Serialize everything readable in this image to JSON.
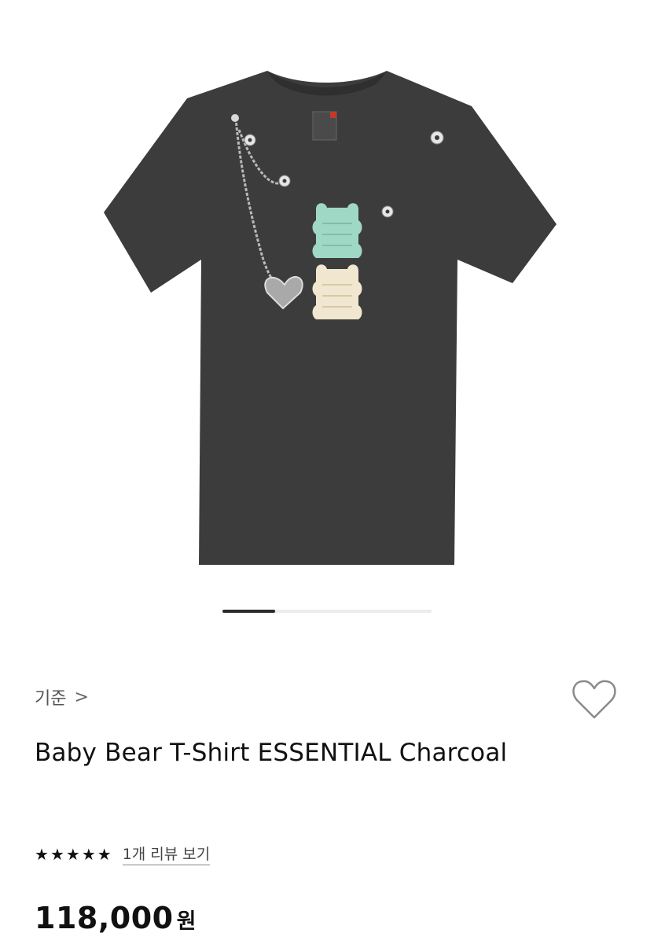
{
  "product": {
    "brand_label": "기준",
    "brand_chevron": ">",
    "title": "Baby Bear T-Shirt ESSENTIAL Charcoal",
    "rating_stars": 5,
    "review_link": "1개 리뷰 보기",
    "price": "118,000",
    "price_unit": "원"
  },
  "carousel": {
    "progress": 0.25
  },
  "icons": {
    "wishlist": "heart-outline-icon",
    "star": "star-filled-icon"
  },
  "colors": {
    "shirt": "#3c3c3c",
    "mint_patch": "#9fd8c4",
    "cream_patch": "#f1e6cf",
    "accent_text": "#111111"
  }
}
